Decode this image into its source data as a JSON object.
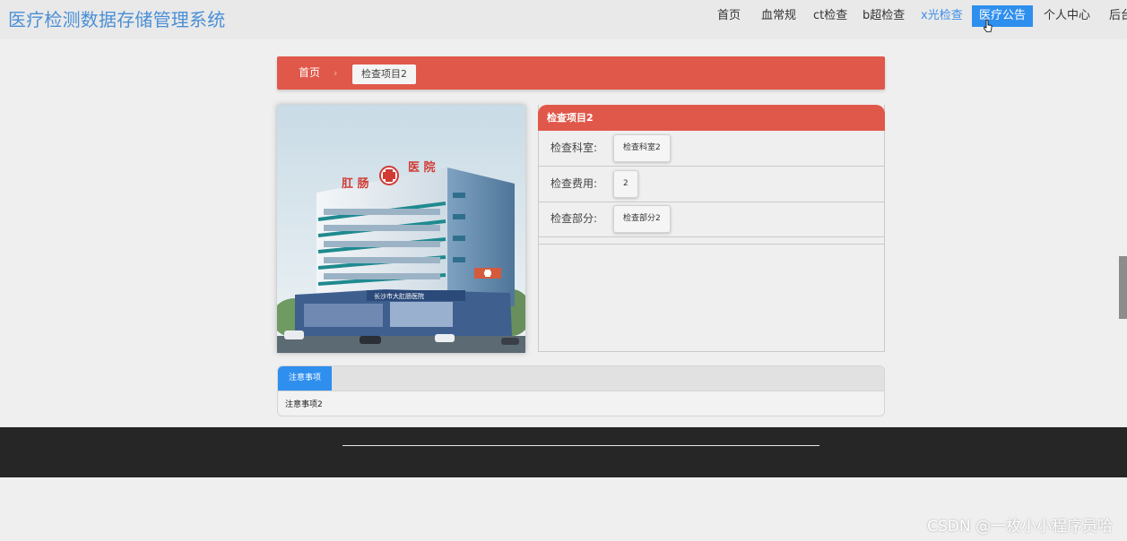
{
  "header": {
    "title": "医疗检测数据存储管理系统",
    "nav": [
      {
        "label": "首页"
      },
      {
        "label": "血常规"
      },
      {
        "label": "ct检查"
      },
      {
        "label": "b超检查"
      },
      {
        "label": "x光检查"
      },
      {
        "label": "医疗公告"
      },
      {
        "label": "个人中心"
      },
      {
        "label": "后台"
      }
    ]
  },
  "breadcrumb": {
    "home": "首页",
    "separator": "›",
    "current": "检查项目2"
  },
  "photo": {
    "sign_left": "肛 肠",
    "sign_right": "医 院",
    "lower_sign": "长沙市大肛肠医院"
  },
  "detail": {
    "heading": "检查项目2",
    "rows": [
      {
        "label": "检查科室:",
        "value": "检查科室2"
      },
      {
        "label": "检查费用:",
        "value": "2"
      },
      {
        "label": "检查部分:",
        "value": "检查部分2"
      }
    ]
  },
  "notes": {
    "tab": "注意事项",
    "content": "注意事项2"
  },
  "watermark": "CSDN @一枚小小程序员哈",
  "colors": {
    "primary_red": "#e0584a",
    "accent_blue": "#2f8fee",
    "title_blue": "#4a8fd6",
    "footer_dark": "#262626"
  },
  "icons": [
    "mouse-cursor-icon",
    "medical-cross-icon"
  ]
}
